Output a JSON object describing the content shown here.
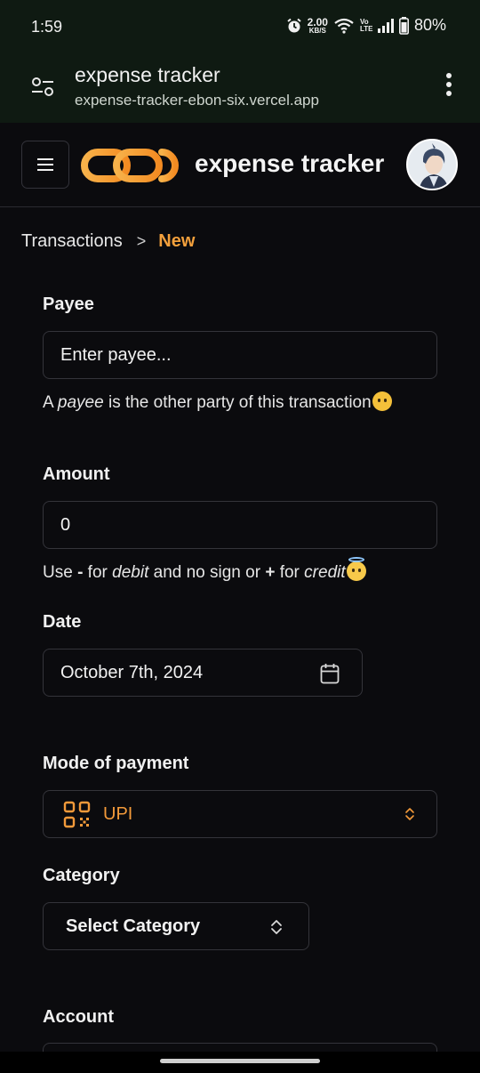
{
  "status_bar": {
    "time": "1:59",
    "net_speed_value": "2.00",
    "net_speed_unit": "KB/S",
    "volte_label": "Vo LTE",
    "battery": "80%"
  },
  "browser": {
    "page_title": "expense tracker",
    "url": "expense-tracker-ebon-six.vercel.app"
  },
  "app_header": {
    "brand": "expense tracker",
    "accent_color": "#f3a03c"
  },
  "breadcrumb": {
    "parent": "Transactions",
    "separator": ">",
    "current": "New"
  },
  "form": {
    "payee": {
      "label": "Payee",
      "value": "Enter payee...",
      "help_prefix": "A ",
      "help_em": "payee",
      "help_suffix": " is the other party of this transaction"
    },
    "amount": {
      "label": "Amount",
      "value": "0",
      "help_1": "Use ",
      "help_minus": "-",
      "help_2": " for ",
      "help_debit": "debit",
      "help_3": " and no sign or ",
      "help_plus": "+",
      "help_4": " for ",
      "help_credit": "credit"
    },
    "date": {
      "label": "Date",
      "value": "October 7th, 2024"
    },
    "mode_of_payment": {
      "label": "Mode of payment",
      "selected": "UPI"
    },
    "category": {
      "label": "Category",
      "selected": "Select Category"
    },
    "account": {
      "label": "Account"
    }
  }
}
